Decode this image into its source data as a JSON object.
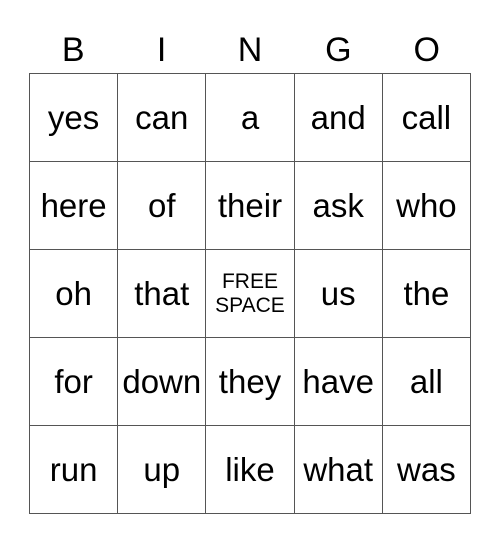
{
  "header": {
    "letters": [
      "B",
      "I",
      "N",
      "G",
      "O"
    ]
  },
  "card": {
    "rows": [
      [
        "yes",
        "can",
        "a",
        "and",
        "call"
      ],
      [
        "here",
        "of",
        "their",
        "ask",
        "who"
      ],
      [
        "oh",
        "that",
        "FREE SPACE",
        "us",
        "the"
      ],
      [
        "for",
        "down",
        "they",
        "have",
        "all"
      ],
      [
        "run",
        "up",
        "like",
        "what",
        "was"
      ]
    ],
    "free_space_label": "FREE SPACE"
  }
}
